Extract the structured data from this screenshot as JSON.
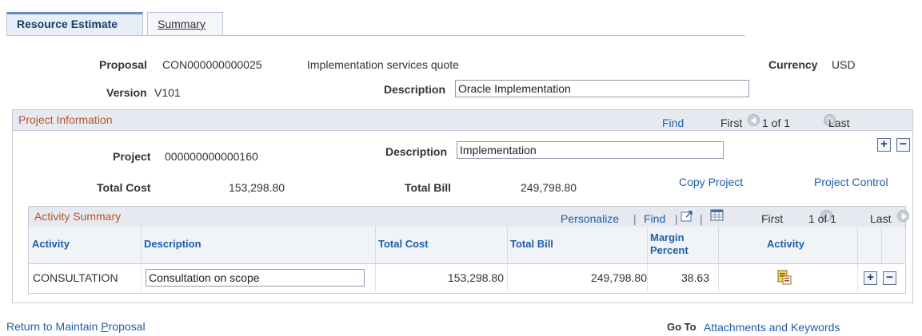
{
  "tabs": {
    "active_label": "Resource Estimate",
    "inactive_label": "Summary"
  },
  "header": {
    "proposal_label": "Proposal",
    "proposal_value": "CON000000000025",
    "proposal_desc": "Implementation services quote",
    "currency_label": "Currency",
    "currency_value": "USD",
    "version_label": "Version",
    "version_value": "V101",
    "description_label": "Description",
    "description_value": "Oracle Implementation"
  },
  "project_info": {
    "title": "Project Information",
    "find_label": "Find",
    "first_label": "First",
    "count_label": "1 of 1",
    "last_label": "Last",
    "project_label": "Project",
    "project_value": "000000000000160",
    "description_label": "Description",
    "description_value": "Implementation",
    "total_cost_label": "Total Cost",
    "total_cost_value": "153,298.80",
    "total_bill_label": "Total Bill",
    "total_bill_value": "249,798.80",
    "copy_project_label": "Copy Project",
    "project_control_label": "Project Control"
  },
  "activity_summary": {
    "title": "Activity Summary",
    "personalize_label": "Personalize",
    "find_label": "Find",
    "first_label": "First",
    "count_label": "1 of 1",
    "last_label": "Last",
    "columns": [
      "Activity",
      "Description",
      "Total Cost",
      "Total Bill",
      "Margin Percent",
      "Activity"
    ],
    "rows": [
      {
        "activity": "CONSULTATION",
        "description": "Consultation on scope",
        "total_cost": "153,298.80",
        "total_bill": "249,798.80",
        "margin": "38.63"
      }
    ]
  },
  "footer": {
    "return_prefix": "Return to Maintain ",
    "return_underlined": "P",
    "return_suffix": "roposal",
    "goto_label": "Go To",
    "goto_link": "Attachments and Keywords"
  },
  "icons": {
    "prev": "left-arrow-circle-icon",
    "next": "right-arrow-circle-icon",
    "add": "plus-icon",
    "remove": "minus-icon",
    "zoom": "new-window-icon",
    "download": "grid-download-icon",
    "activity_detail": "activity-detail-icon"
  }
}
